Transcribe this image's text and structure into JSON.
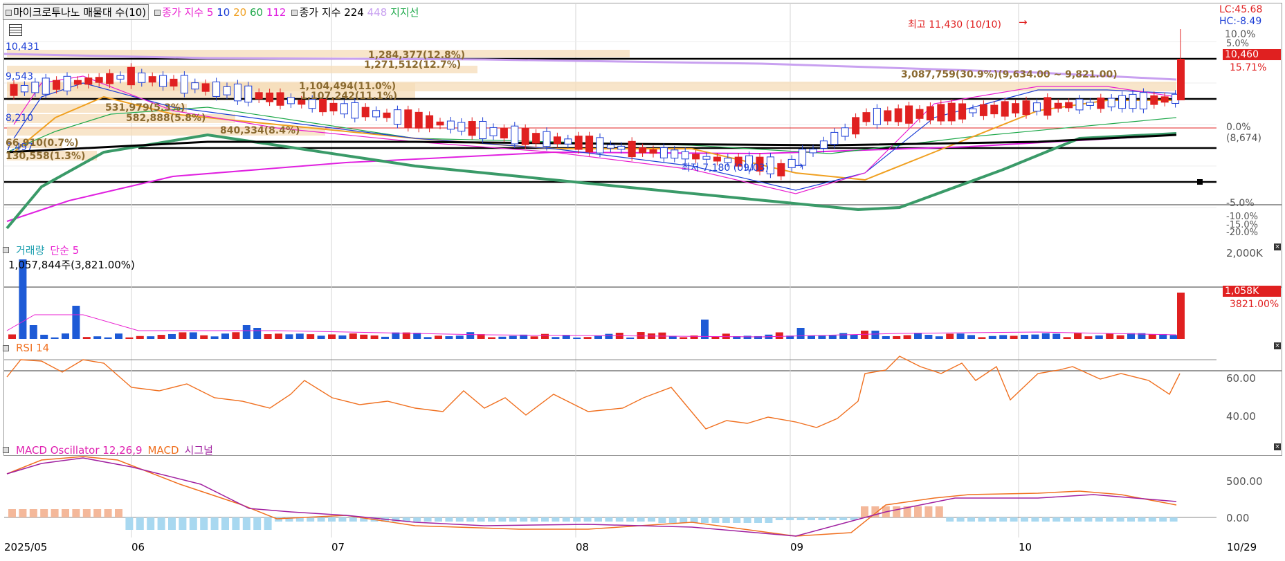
{
  "price_panel": {
    "legend": {
      "title_box": "마이크로투나노 매물대 수(10)",
      "ma_label": "종가 지수",
      "ma_periods": [
        {
          "label": "5",
          "color": "#e91fd0"
        },
        {
          "label": "10",
          "color": "#1d3fd6"
        },
        {
          "label": "20",
          "color": "#f0a020"
        },
        {
          "label": "60",
          "color": "#1ea84a"
        },
        {
          "label": "112",
          "color": "#e020e0"
        }
      ],
      "ma_label2": "종가 지수 224",
      "ma_448": "448",
      "support": "지지선"
    },
    "top_right": {
      "lc": "LC:45.68",
      "hc": "HC:-8.49"
    },
    "high_annotation": "최고 11,430 (10/10)",
    "low_annotation": "최저 7,180 (09/03)",
    "left_price_labels": [
      "10,431",
      "9,543",
      "8,210",
      "7,497"
    ],
    "volume_profile_labels": [
      "1,284,377(12.8%)",
      "1,271,512(12.7%)",
      "1,104,494(11.0%)",
      "1,107,242(11.1%)",
      "531,979(5.3%)",
      "582,888(5.8%)",
      "840,334(8.4%)",
      "66,910(0.7%)",
      "130,558(1.3%)",
      "3,087,759(30.9%)(9,634.00 ~ 9,821.00)"
    ],
    "axis_labels": [
      "10.0%",
      "5.0%",
      "0.0%",
      "(8,674)",
      "-5.0%",
      "-10.0%",
      "-15.0%",
      "-20.0%"
    ],
    "current_price_tag": "10,460",
    "current_pct": "15.71%"
  },
  "volume_panel": {
    "legend_name": "거래량",
    "legend_ma": "단순 5",
    "info": "1,057,844주(3,821.00%)",
    "axis_top": "2,000K",
    "current_tag": "1,058K",
    "current_pct": "3821.00%"
  },
  "rsi_panel": {
    "legend": "RSI 14",
    "axis_labels": [
      "60.00",
      "40.00"
    ]
  },
  "macd_panel": {
    "legend_osc": "MACD Oscillator 12,26,9",
    "legend_macd": "MACD",
    "legend_signal": "시그널",
    "axis_labels": [
      "500.00",
      "0.00"
    ]
  },
  "x_axis": {
    "labels": [
      "2025/05",
      "06",
      "07",
      "08",
      "09",
      "10",
      "10/29"
    ]
  },
  "chart_data": [
    {
      "type": "candlestick",
      "title": "마이크로투나노 매물대 수(10)",
      "x_range": [
        "2025/05",
        "10/29"
      ],
      "annotations": {
        "high": {
          "value": 11430,
          "date": "10/10"
        },
        "low": {
          "value": 7180,
          "date": "09/03"
        }
      },
      "reference_price": 8674,
      "last_close": 10460,
      "last_change_pct": 15.71,
      "series_names": [
        "5",
        "10",
        "20",
        "60",
        "112",
        "224",
        "448"
      ]
    },
    {
      "type": "bar",
      "title": "거래량",
      "last_value": 1057844,
      "last_pct": 3821.0,
      "ylim": [
        0,
        2000000
      ]
    },
    {
      "type": "line",
      "title": "RSI 14",
      "ylim": [
        30,
        80
      ],
      "ticks": [
        40,
        60
      ]
    },
    {
      "type": "line",
      "title": "MACD Oscillator 12,26,9",
      "ticks": [
        0,
        500
      ]
    }
  ]
}
